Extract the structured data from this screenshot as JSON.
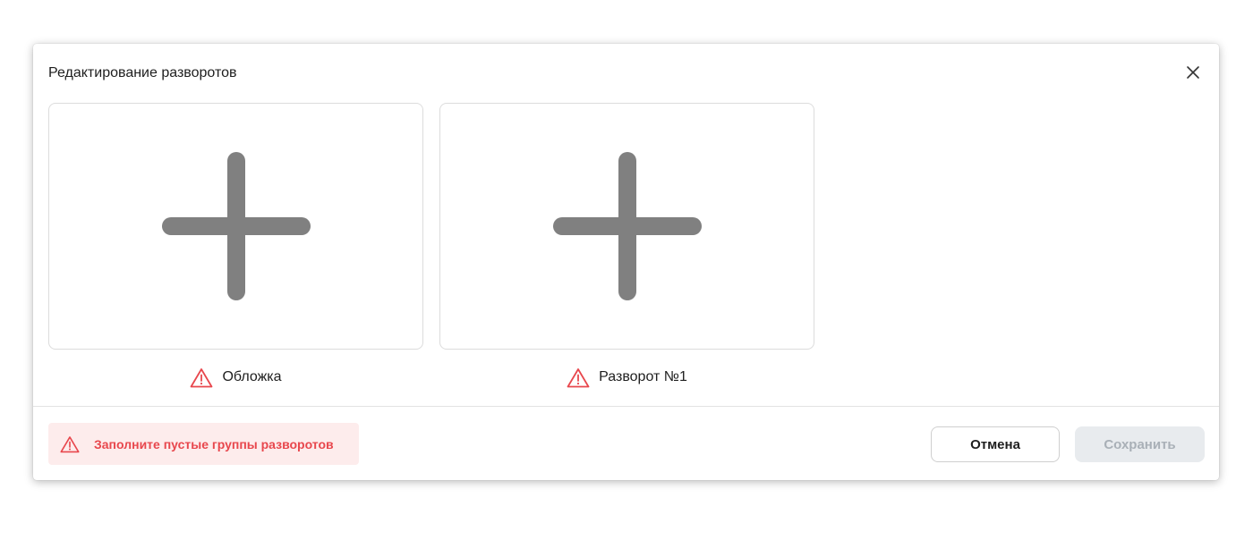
{
  "dialog": {
    "title": "Редактирование разворотов"
  },
  "spreads": [
    {
      "label": "Обложка",
      "status": "warning"
    },
    {
      "label": "Разворот №1",
      "status": "warning"
    }
  ],
  "footer": {
    "error_message": "Заполните пустые группы разворотов",
    "cancel_label": "Отмена",
    "save_label": "Сохранить"
  },
  "icons": {
    "close": "close-icon",
    "add": "plus-icon",
    "warning": "warning-triangle-icon"
  },
  "colors": {
    "warning": "#e8474d",
    "error_bg": "#fdecec",
    "plus": "#808080",
    "disabled_bg": "#e8ebee",
    "disabled_text": "#a9b0b7"
  }
}
